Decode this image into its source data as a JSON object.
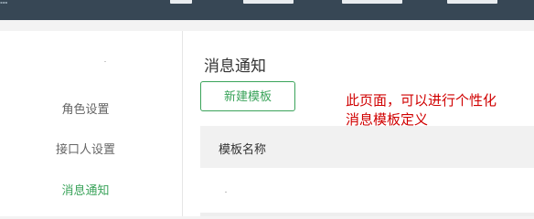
{
  "topbar": {
    "logo_icon": "brand-logo-icon",
    "background": "#374755"
  },
  "sidebar": {
    "items": [
      {
        "label": "角色设置",
        "active": false
      },
      {
        "label": "接口人设置",
        "active": false
      },
      {
        "label": "消息通知",
        "active": true
      }
    ],
    "active_color": "#3aa35a"
  },
  "main": {
    "title": "消息通知",
    "new_button_label": "新建模板",
    "table": {
      "columns": [
        "模板名称"
      ]
    }
  },
  "annotation": {
    "lines": [
      "此页面，可以进行个性化",
      "消息模板定义"
    ],
    "color": "#d00000"
  }
}
